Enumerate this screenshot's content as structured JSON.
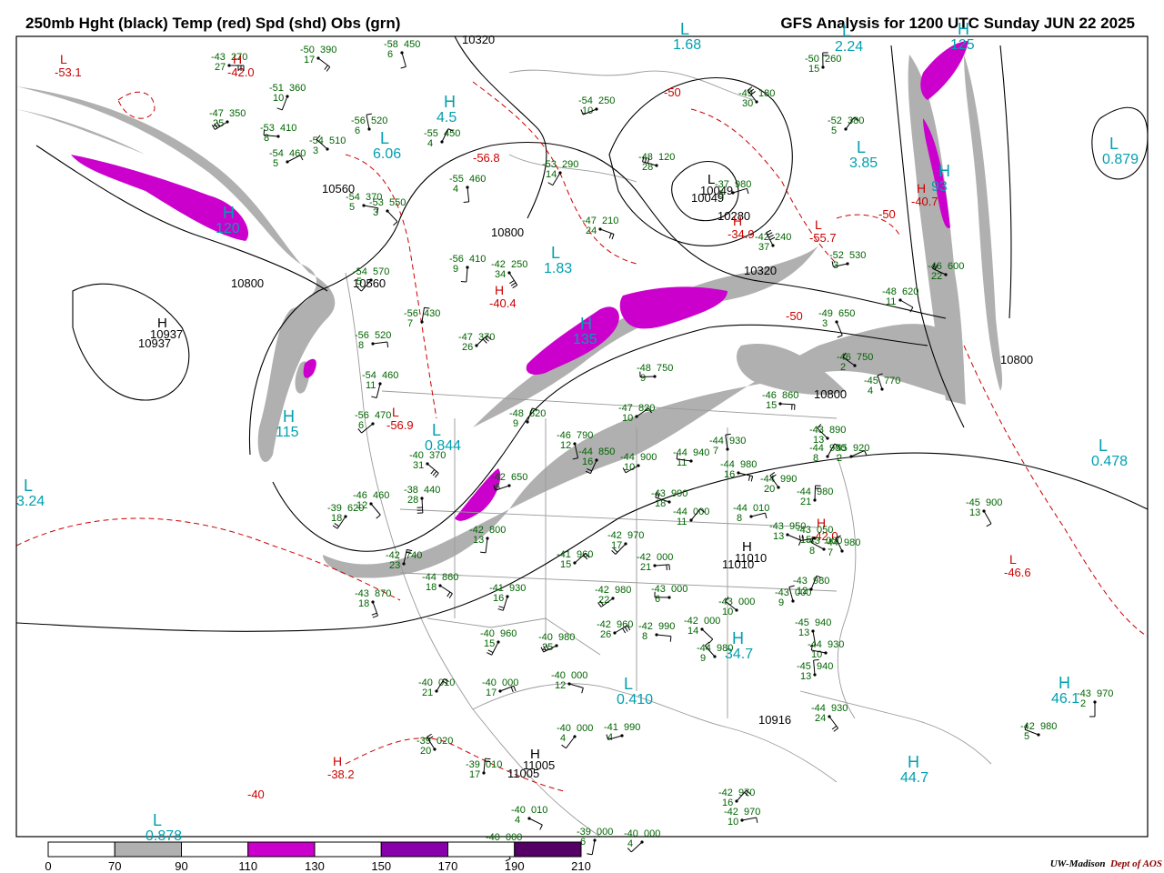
{
  "header": {
    "title_left": "250mb Hght (black) Temp (red) Spd (shd) Obs (grn)",
    "title_right": "GFS Analysis for 1200 UTC Sunday  JUN 22 2025"
  },
  "footer": {
    "credit_a": "UW-Madison",
    "credit_b": "Dept of AOS"
  },
  "colors": {
    "height": "#000000",
    "temp": "#cc0000",
    "obs": "#006400",
    "center": "#00a0b0",
    "speed_70": "#b0b0b0",
    "speed_110": "#cc00cc",
    "speed_150": "#8800aa",
    "speed_190": "#550066"
  },
  "legend": {
    "ticks": [
      "0",
      "70",
      "90",
      "110",
      "130",
      "150",
      "170",
      "190",
      "210"
    ],
    "fills": [
      "#ffffff",
      "#b0b0b0",
      "#ffffff",
      "#cc00cc",
      "#ffffff",
      "#8800aa",
      "#ffffff",
      "#550066",
      "#ffffff"
    ]
  },
  "height_labels": [
    "10320",
    "10560",
    "10800",
    "10560",
    "10937",
    "10800",
    "10800",
    "10800",
    "11005",
    "10916",
    "11010",
    "10280",
    "10049",
    "10320"
  ],
  "pressure_centers": [
    {
      "letter": "H",
      "value": "10937",
      "kind": "height"
    },
    {
      "letter": "H",
      "value": "11005",
      "kind": "height"
    },
    {
      "letter": "H",
      "value": "11010",
      "kind": "height"
    },
    {
      "letter": "L",
      "value": "10049",
      "kind": "height"
    },
    {
      "letter": "L",
      "value": "1.68",
      "kind": "center"
    },
    {
      "letter": "L",
      "value": "2.24",
      "kind": "center"
    },
    {
      "letter": "L",
      "value": "3.85",
      "kind": "center"
    },
    {
      "letter": "L",
      "value": "6.06",
      "kind": "center"
    },
    {
      "letter": "L",
      "value": "1.83",
      "kind": "center"
    },
    {
      "letter": "L",
      "value": "0.844",
      "kind": "center"
    },
    {
      "letter": "L",
      "value": "0.478",
      "kind": "center"
    },
    {
      "letter": "L",
      "value": "0.410",
      "kind": "center"
    },
    {
      "letter": "L",
      "value": "3.24",
      "kind": "center"
    },
    {
      "letter": "L",
      "value": "0.878",
      "kind": "center"
    },
    {
      "letter": "L",
      "value": "0.879",
      "kind": "center"
    },
    {
      "letter": "H",
      "value": "120",
      "kind": "center"
    },
    {
      "letter": "H",
      "value": "135",
      "kind": "center"
    },
    {
      "letter": "H",
      "value": "115",
      "kind": "center"
    },
    {
      "letter": "H",
      "value": "125",
      "kind": "center"
    },
    {
      "letter": "H",
      "value": "93",
      "kind": "center"
    },
    {
      "letter": "H",
      "value": "4.5",
      "kind": "center"
    },
    {
      "letter": "H",
      "value": "34.7",
      "kind": "center"
    },
    {
      "letter": "H",
      "value": "46.1",
      "kind": "center"
    },
    {
      "letter": "H",
      "value": "44.7",
      "kind": "center"
    }
  ],
  "temp_labels": [
    {
      "letter": "L",
      "value": "-53.1"
    },
    {
      "letter": "H",
      "value": "-42.0"
    },
    {
      "letter": "",
      "value": "-56.8"
    },
    {
      "letter": "H",
      "value": "-40.4"
    },
    {
      "letter": "H",
      "value": "-34.9"
    },
    {
      "letter": "H",
      "value": "-40.7"
    },
    {
      "letter": "",
      "value": "-50"
    },
    {
      "letter": "L",
      "value": "-56.9"
    },
    {
      "letter": "H",
      "value": "-38.2"
    },
    {
      "letter": "",
      "value": "-40"
    },
    {
      "letter": "L",
      "value": "-46.6"
    },
    {
      "letter": "H",
      "value": "-42.0"
    },
    {
      "letter": "",
      "value": "-50"
    },
    {
      "letter": "",
      "value": "-50"
    },
    {
      "letter": "L",
      "value": "-55.7"
    }
  ],
  "observations": [
    {
      "t": "-43",
      "h": "270",
      "s": "27"
    },
    {
      "t": "-50",
      "h": "390",
      "s": "17"
    },
    {
      "t": "-58",
      "h": "450",
      "s": "6"
    },
    {
      "t": "-51",
      "h": "360",
      "s": "10"
    },
    {
      "t": "-47",
      "h": "350",
      "s": "25"
    },
    {
      "t": "-53",
      "h": "410",
      "s": "8"
    },
    {
      "t": "-54",
      "h": "510",
      "s": "3"
    },
    {
      "t": "-56",
      "h": "520",
      "s": "6"
    },
    {
      "t": "-55",
      "h": "450",
      "s": "4"
    },
    {
      "t": "-54",
      "h": "460",
      "s": "5"
    },
    {
      "t": "-54",
      "h": "370",
      "s": "5"
    },
    {
      "t": "-53",
      "h": "550",
      "s": "3"
    },
    {
      "t": "-55",
      "h": "460",
      "s": "4"
    },
    {
      "t": "-53",
      "h": "290",
      "s": "14"
    },
    {
      "t": "-54",
      "h": "250",
      "s": "10"
    },
    {
      "t": "-48",
      "h": "120",
      "s": "28"
    },
    {
      "t": "-49",
      "h": "180",
      "s": "30"
    },
    {
      "t": "-50",
      "h": "260",
      "s": "15"
    },
    {
      "t": "-52",
      "h": "380",
      "s": "5"
    },
    {
      "t": "-37",
      "h": "980",
      "s": "5"
    },
    {
      "t": "-47",
      "h": "210",
      "s": "24"
    },
    {
      "t": "-42",
      "h": "250",
      "s": "34"
    },
    {
      "t": "-56",
      "h": "410",
      "s": "9"
    },
    {
      "t": "-54",
      "h": "570",
      "s": "5"
    },
    {
      "t": "-52",
      "h": "530",
      "s": "3"
    },
    {
      "t": "-46",
      "h": "600",
      "s": "22"
    },
    {
      "t": "-42",
      "h": "240",
      "s": "37"
    },
    {
      "t": "-56",
      "h": "430",
      "s": "7"
    },
    {
      "t": "-47",
      "h": "370",
      "s": "26"
    },
    {
      "t": "-56",
      "h": "520",
      "s": "8"
    },
    {
      "t": "-48",
      "h": "620",
      "s": "11"
    },
    {
      "t": "-49",
      "h": "650",
      "s": "3"
    },
    {
      "t": "-54",
      "h": "460",
      "s": "11"
    },
    {
      "t": "-56",
      "h": "470",
      "s": "6"
    },
    {
      "t": "-48",
      "h": "750",
      "s": "9"
    },
    {
      "t": "-46",
      "h": "750",
      "s": "2"
    },
    {
      "t": "-45",
      "h": "770",
      "s": "4"
    },
    {
      "t": "-48",
      "h": "620",
      "s": "9"
    },
    {
      "t": "-47",
      "h": "820",
      "s": "10"
    },
    {
      "t": "-46",
      "h": "860",
      "s": "15"
    },
    {
      "t": "-40",
      "h": "370",
      "s": "31"
    },
    {
      "t": "-46",
      "h": "790",
      "s": "12"
    },
    {
      "t": "-44",
      "h": "850",
      "s": "16"
    },
    {
      "t": "-44",
      "h": "900",
      "s": "10"
    },
    {
      "t": "-44",
      "h": "940",
      "s": "11"
    },
    {
      "t": "-43",
      "h": "890",
      "s": "13"
    },
    {
      "t": "-44",
      "h": "930",
      "s": "7"
    },
    {
      "t": "-44",
      "h": "950",
      "s": "8"
    },
    {
      "t": "-45",
      "h": "920",
      "s": "2"
    },
    {
      "t": "-44",
      "h": "980",
      "s": "16"
    },
    {
      "t": "-46",
      "h": "460",
      "s": "12"
    },
    {
      "t": "-38",
      "h": "440",
      "s": "28"
    },
    {
      "t": "-39",
      "h": "620",
      "s": "18"
    },
    {
      "t": "-42",
      "h": "650",
      "s": "6"
    },
    {
      "t": "-43",
      "h": "990",
      "s": "18"
    },
    {
      "t": "-44",
      "h": "990",
      "s": "20"
    },
    {
      "t": "-44",
      "h": "980",
      "s": "21"
    },
    {
      "t": "-44",
      "h": "000",
      "s": "11"
    },
    {
      "t": "-44",
      "h": "010",
      "s": "8"
    },
    {
      "t": "-43",
      "h": "950",
      "s": "13"
    },
    {
      "t": "-45",
      "h": "900",
      "s": "13"
    },
    {
      "t": "-42",
      "h": "800",
      "s": "13"
    },
    {
      "t": "-42",
      "h": "970",
      "s": "17"
    },
    {
      "t": "-43",
      "h": "050",
      "s": "15"
    },
    {
      "t": "-43",
      "h": "000",
      "s": "8"
    },
    {
      "t": "-44",
      "h": "980",
      "s": "7"
    },
    {
      "t": "-42",
      "h": "740",
      "s": "23"
    },
    {
      "t": "-41",
      "h": "960",
      "s": "15"
    },
    {
      "t": "-42",
      "h": "000",
      "s": "21"
    },
    {
      "t": "-44",
      "h": "860",
      "s": "18"
    },
    {
      "t": "-43",
      "h": "870",
      "s": "18"
    },
    {
      "t": "-41",
      "h": "930",
      "s": "16"
    },
    {
      "t": "-42",
      "h": "980",
      "s": "22"
    },
    {
      "t": "-43",
      "h": "000",
      "s": "6"
    },
    {
      "t": "-43",
      "h": "000",
      "s": "10"
    },
    {
      "t": "-43",
      "h": "000",
      "s": "9"
    },
    {
      "t": "-43",
      "h": "980",
      "s": "12"
    },
    {
      "t": "-42",
      "h": "960",
      "s": "26"
    },
    {
      "t": "-42",
      "h": "990",
      "s": "8"
    },
    {
      "t": "-42",
      "h": "000",
      "s": "14"
    },
    {
      "t": "-45",
      "h": "940",
      "s": "13"
    },
    {
      "t": "-40",
      "h": "960",
      "s": "15"
    },
    {
      "t": "-40",
      "h": "980",
      "s": "25"
    },
    {
      "t": "-44",
      "h": "930",
      "s": "10"
    },
    {
      "t": "-44",
      "h": "980",
      "s": "9"
    },
    {
      "t": "-45",
      "h": "940",
      "s": "13"
    },
    {
      "t": "-40",
      "h": "010",
      "s": "21"
    },
    {
      "t": "-40",
      "h": "000",
      "s": "17"
    },
    {
      "t": "-40",
      "h": "000",
      "s": "12"
    },
    {
      "t": "-44",
      "h": "930",
      "s": "24"
    },
    {
      "t": "-43",
      "h": "970",
      "s": "2"
    },
    {
      "t": "-40",
      "h": "000",
      "s": "4"
    },
    {
      "t": "-41",
      "h": "990",
      "s": "4"
    },
    {
      "t": "-42",
      "h": "980",
      "s": "5"
    },
    {
      "t": "-39",
      "h": "020",
      "s": "20"
    },
    {
      "t": "-39",
      "h": "010",
      "s": "17"
    },
    {
      "t": "-42",
      "h": "970",
      "s": "16"
    },
    {
      "t": "-42",
      "h": "970",
      "s": "10"
    },
    {
      "t": "-40",
      "h": "010",
      "s": "4"
    },
    {
      "t": "-40",
      "h": "000",
      "s": "8"
    },
    {
      "t": "-39",
      "h": "000",
      "s": "6"
    },
    {
      "t": "-40",
      "h": "000",
      "s": "4"
    }
  ]
}
